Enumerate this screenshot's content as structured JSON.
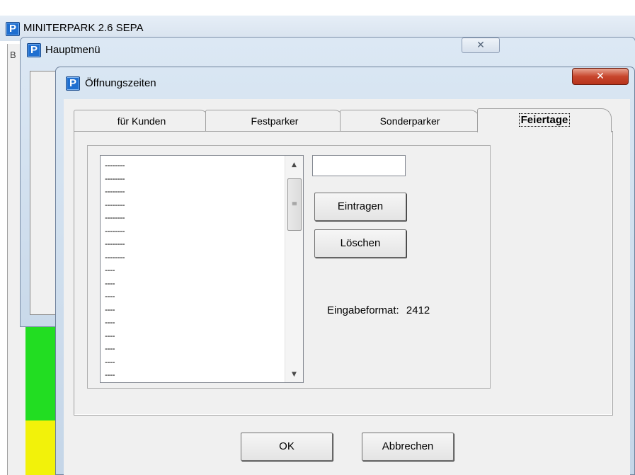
{
  "app_window": {
    "title": "MINITERPARK 2.6  SEPA",
    "client_letter": "B",
    "icon": "parking-p-icon",
    "status_colors": {
      "green": "#22dd22",
      "yellow": "#f2f20a"
    }
  },
  "main_menu_window": {
    "title": "Hauptmenü",
    "close_glyph": "✕"
  },
  "dialog": {
    "title": "Öffnungszeiten",
    "close_glyph": "✕",
    "tabs": [
      {
        "label": "für Kunden",
        "active": false
      },
      {
        "label": "Festparker",
        "active": false
      },
      {
        "label": "Sonderparker",
        "active": false
      },
      {
        "label": "Feiertage",
        "active": true
      }
    ],
    "holiday_list": {
      "items": [
        "--------",
        "--------",
        "--------",
        "--------",
        "--------",
        "--------",
        "--------",
        "--------",
        "----",
        "----",
        "----",
        "----",
        "----",
        "----",
        "----",
        "----",
        "----"
      ]
    },
    "date_input": {
      "value": ""
    },
    "enter_button": "Eintragen",
    "delete_button": "Löschen",
    "format_label": "Eingabeformat:",
    "format_value": "2412",
    "ok_button": "OK",
    "cancel_button": "Abbrechen"
  },
  "colors": {
    "close_red": "#c7462d",
    "window_frame": "#d9e6f3",
    "icon_blue": "#1f6fd0"
  }
}
